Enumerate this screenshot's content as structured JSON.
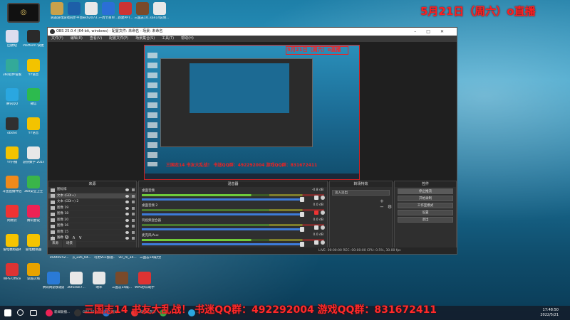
{
  "overlay": {
    "date": "5月21日（周六）o直播",
    "bottom_banner": "三国志14 书友大乱战！ 书迷QQ群：492292004    游戏QQ群：831672411"
  },
  "desktop_icons_top": [
    {
      "label": "逍遥游戏",
      "color": "#c9a14b"
    },
    {
      "label": "游戏同步平台...",
      "color": "#1d5fa8"
    },
    {
      "label": "wkh2073...",
      "color": "#e8e8e8"
    },
    {
      "label": "一周节目单...",
      "color": "#2b6fd6"
    },
    {
      "label": "新建PPT...",
      "color": "#c33"
    },
    {
      "label": "三国志14...",
      "color": "#7a4a2a"
    },
    {
      "label": "san14说明...",
      "color": "#e8e8e8"
    }
  ],
  "desktop_icons_left": [
    {
      "label": "回收站",
      "color": "#dde"
    },
    {
      "label": "Platform 快捷方式",
      "color": "#2a2a2a"
    },
    {
      "label": "360软件管家",
      "color": "#3a9"
    },
    {
      "label": "YY语音",
      "color": "#f3c300"
    },
    {
      "label": "腾讯QQ",
      "color": "#2aa7e0"
    },
    {
      "label": "微信",
      "color": "#2dba4e"
    },
    {
      "label": "obs64",
      "color": "#303030"
    },
    {
      "label": "YY语音",
      "color": "#f3c300"
    },
    {
      "label": "YY开播",
      "color": "#f3c300"
    },
    {
      "label": "游侠数字 2019121...",
      "color": "#e8e8e8"
    },
    {
      "label": "斗鱼直播伴侣",
      "color": "#f08a1b"
    },
    {
      "label": "360安全卫士",
      "color": "#3ab54a"
    },
    {
      "label": "网易云",
      "color": "#e33"
    },
    {
      "label": "腾讯会议",
      "color": "#e25"
    },
    {
      "label": "雷电模拟器4",
      "color": "#f5c400"
    },
    {
      "label": "雷电模拟器",
      "color": "#f5c400"
    },
    {
      "label": "WPS Office",
      "color": "#d33"
    },
    {
      "label": "穿越火线",
      "color": "#e7a200"
    }
  ],
  "desktop_icons_bottom": [
    {
      "label": "16449252...",
      "color": "#e8e8e8"
    },
    {
      "label": "p_226_04...",
      "color": "#e8e8e8"
    },
    {
      "label": "可用VLC加速...",
      "color": "#e8e8e8"
    },
    {
      "label": "vlc_m_34...",
      "color": "#e8e8e8"
    },
    {
      "label": "三国志14威力加强版",
      "color": "#7a4a2a"
    },
    {
      "label": "腾讯网游加速器",
      "color": "#2a7ad6"
    },
    {
      "label": "36f5e8e7...",
      "color": "#e8e8e8"
    },
    {
      "label": "明率",
      "color": "#e8e8e8"
    },
    {
      "label": "三国志14威...",
      "color": "#7a4a2a"
    },
    {
      "label": "WPS办公助手",
      "color": "#d33"
    }
  ],
  "obs": {
    "title": "OBS 25.0.4 (64-bit, windows) - 配置文件: 未命名 - 场景: 未命名",
    "menu": [
      "文件(F)",
      "编辑(E)",
      "查看(V)",
      "配置文件(P)",
      "场景集合(S)",
      "工具(T)",
      "帮助(H)"
    ],
    "docks": {
      "sources_title": "来源",
      "mixer_title": "混音器",
      "transition_title": "转场特效",
      "controls_title": "控件"
    },
    "sources": [
      {
        "name": "图标排",
        "selected": false
      },
      {
        "name": "文本 (GDI+)",
        "selected": true
      },
      {
        "name": "文本 (GDI+) 2",
        "selected": false
      },
      {
        "name": "图像 19",
        "selected": false
      },
      {
        "name": "图像 18",
        "selected": false
      },
      {
        "name": "图像 20",
        "selected": false
      },
      {
        "name": "图像 16",
        "selected": false
      },
      {
        "name": "图像 15",
        "selected": false
      },
      {
        "name": "图像 14",
        "selected": false
      }
    ],
    "source_tabs": [
      "来源",
      "场景"
    ],
    "mixer": [
      {
        "name": "桌面音频",
        "db": "-0.8 dB",
        "active": true,
        "level": 0.97,
        "muted": false
      },
      {
        "name": "桌面音频 2",
        "db": "0.0 dB",
        "active": false,
        "level": 0.97,
        "muted": true
      },
      {
        "name": "玩视频混合器",
        "db": "0.0 dB",
        "active": false,
        "level": 0.97,
        "muted": false
      },
      {
        "name": "麦克风/Aux",
        "db": "0.0 dB",
        "active": true,
        "level": 0.97,
        "muted": false
      }
    ],
    "transition": {
      "selected": "淡入淡出"
    },
    "controls": [
      {
        "label": "停止推流",
        "highlight": true
      },
      {
        "label": "开始录制",
        "highlight": false
      },
      {
        "label": "工作室模式",
        "highlight": false
      },
      {
        "label": "设置",
        "highlight": false
      },
      {
        "label": "退出",
        "highlight": false
      }
    ],
    "status": "LIVE: 00:00:00    REC: 00:00:00    CPU: 0.5%, 30.00 fps"
  },
  "taskbar": {
    "apps": [
      {
        "label": "新闻联播...",
        "color": "#e25"
      },
      {
        "label": "OBS 25.0.4...",
        "color": "#333"
      },
      {
        "label": "图片...",
        "color": "#2a7ad6"
      },
      {
        "label": "网易云音乐",
        "color": "#e33"
      },
      {
        "label": "...",
        "color": "#3ab54a"
      },
      {
        "label": "...",
        "color": "#2aa7e0"
      }
    ],
    "time": "17:48:50",
    "date": "2022/5/21"
  },
  "colors": {
    "accent_red": "#ff2020",
    "obs_bg": "#2b2b2b",
    "slider_blue": "#3d7bd9"
  }
}
